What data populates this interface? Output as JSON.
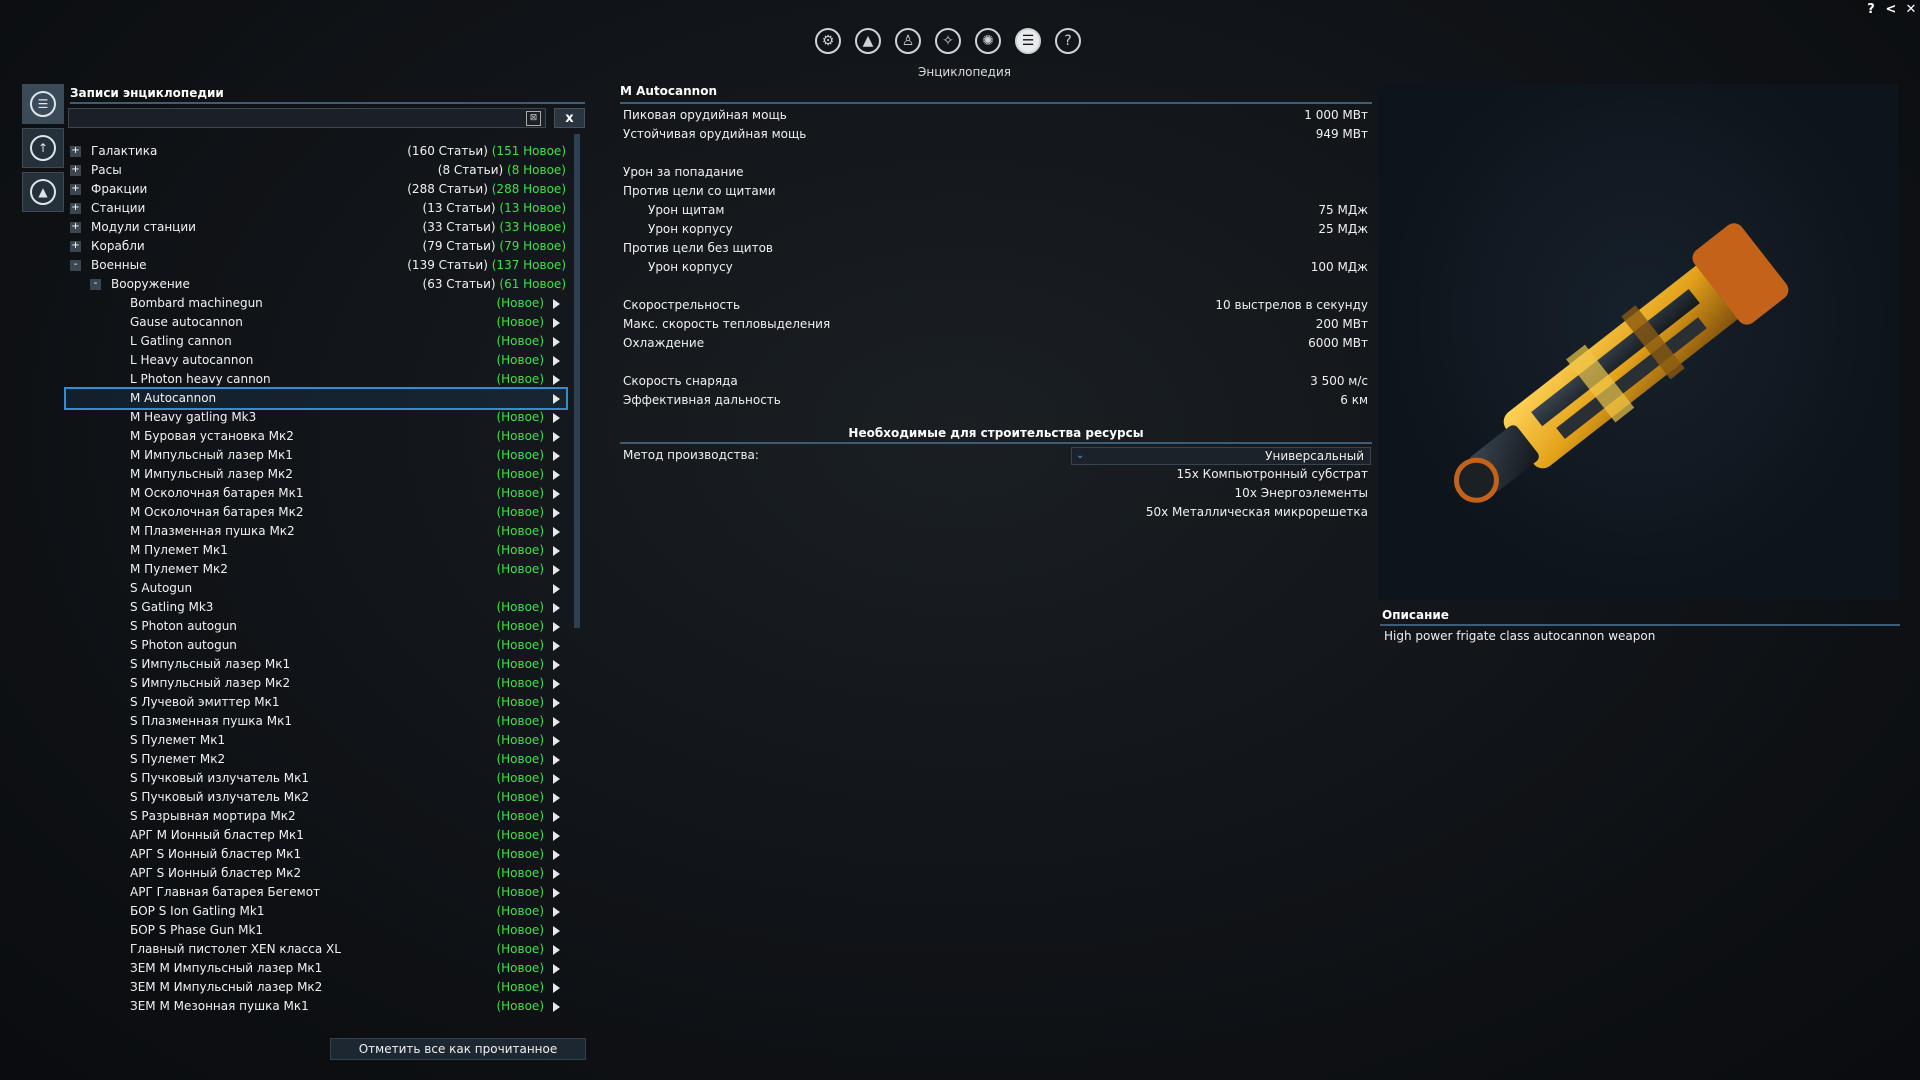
{
  "window_buttons": [
    "?",
    "<",
    "✕"
  ],
  "top_tabs": {
    "icons": [
      "settings-icon",
      "ship-icon",
      "person-icon",
      "rank-icon",
      "network-icon",
      "encyclopedia-icon",
      "help-icon"
    ],
    "glyphs": [
      "⚙",
      "▲",
      "♙",
      "✧",
      "✺",
      "☰",
      "?"
    ],
    "active_index": 5,
    "caption": "Энциклопедия"
  },
  "side_icons": [
    {
      "name": "encyclopedia-side-icon",
      "glyph": "☰",
      "active": true
    },
    {
      "name": "compass-side-icon",
      "glyph": "↑",
      "active": false
    },
    {
      "name": "ship-side-icon",
      "glyph": "▲",
      "active": false
    }
  ],
  "left_panel": {
    "title": "Записи энциклопедии",
    "search": {
      "value": "",
      "placeholder": ""
    },
    "clear_button": "x",
    "mark_all_read": "Отметить все как прочитанное"
  },
  "tree": [
    {
      "label": "Галактика",
      "level": 0,
      "expander": "+",
      "count": "(160 Статьи)",
      "new": "(151 Новое)"
    },
    {
      "label": "Расы",
      "level": 0,
      "expander": "+",
      "count": "(8 Статьи)",
      "new": "(8 Новое)"
    },
    {
      "label": "Фракции",
      "level": 0,
      "expander": "+",
      "count": "(288 Статьи)",
      "new": "(288 Новое)"
    },
    {
      "label": "Станции",
      "level": 0,
      "expander": "+",
      "count": "(13 Статьи)",
      "new": "(13 Новое)"
    },
    {
      "label": "Модули станции",
      "level": 0,
      "expander": "+",
      "count": "(33 Статьи)",
      "new": "(33 Новое)"
    },
    {
      "label": "Корабли",
      "level": 0,
      "expander": "+",
      "count": "(79 Статьи)",
      "new": "(79 Новое)"
    },
    {
      "label": "Военные",
      "level": 0,
      "expander": "-",
      "count": "(139 Статьи)",
      "new": "(137 Новое)"
    },
    {
      "label": "Вооружение",
      "level": 1,
      "expander": "-",
      "count": "(63 Статьи)",
      "new": "(61 Новое)"
    },
    {
      "label": "Bombard machinegun",
      "level": 2,
      "new": "(Новое)"
    },
    {
      "label": "Gause autocannon",
      "level": 2,
      "new": "(Новое)"
    },
    {
      "label": "L Gatling cannon",
      "level": 2,
      "new": "(Новое)"
    },
    {
      "label": "L Heavy autocannon",
      "level": 2,
      "new": "(Новое)"
    },
    {
      "label": "L Photon heavy cannon",
      "level": 2,
      "new": "(Новое)"
    },
    {
      "label": "M Autocannon",
      "level": 2,
      "new": "",
      "selected": true
    },
    {
      "label": "M Heavy gatling Mk3",
      "level": 2,
      "new": "(Новое)"
    },
    {
      "label": "M Буровая установка Мк2",
      "level": 2,
      "new": "(Новое)"
    },
    {
      "label": "M Импульсный лазер Мк1",
      "level": 2,
      "new": "(Новое)"
    },
    {
      "label": "M Импульсный лазер Мк2",
      "level": 2,
      "new": "(Новое)"
    },
    {
      "label": "M Осколочная батарея Мк1",
      "level": 2,
      "new": "(Новое)"
    },
    {
      "label": "M Осколочная батарея Мк2",
      "level": 2,
      "new": "(Новое)"
    },
    {
      "label": "M Плазменная пушка Мк2",
      "level": 2,
      "new": "(Новое)"
    },
    {
      "label": "M Пулемет Мк1",
      "level": 2,
      "new": "(Новое)"
    },
    {
      "label": "M Пулемет Мк2",
      "level": 2,
      "new": "(Новое)"
    },
    {
      "label": "S Autogun",
      "level": 2,
      "new": ""
    },
    {
      "label": "S Gatling Mk3",
      "level": 2,
      "new": "(Новое)"
    },
    {
      "label": "S Photon autogun",
      "level": 2,
      "new": "(Новое)"
    },
    {
      "label": "S Photon autogun",
      "level": 2,
      "new": "(Новое)"
    },
    {
      "label": "S Импульсный лазер Мк1",
      "level": 2,
      "new": "(Новое)"
    },
    {
      "label": "S Импульсный лазер Мк2",
      "level": 2,
      "new": "(Новое)"
    },
    {
      "label": "S Лучевой эмиттер Мк1",
      "level": 2,
      "new": "(Новое)"
    },
    {
      "label": "S Плазменная пушка Мк1",
      "level": 2,
      "new": "(Новое)"
    },
    {
      "label": "S Пулемет Мк1",
      "level": 2,
      "new": "(Новое)"
    },
    {
      "label": "S Пулемет Мк2",
      "level": 2,
      "new": "(Новое)"
    },
    {
      "label": "S Пучковый излучатель Мк1",
      "level": 2,
      "new": "(Новое)"
    },
    {
      "label": "S Пучковый излучатель Мк2",
      "level": 2,
      "new": "(Новое)"
    },
    {
      "label": "S Разрывная мортира Мк2",
      "level": 2,
      "new": "(Новое)"
    },
    {
      "label": "АРГ M Ионный бластер Мк1",
      "level": 2,
      "new": "(Новое)"
    },
    {
      "label": "АРГ S Ионный бластер Мк1",
      "level": 2,
      "new": "(Новое)"
    },
    {
      "label": "АРГ S Ионный бластер Мк2",
      "level": 2,
      "new": "(Новое)"
    },
    {
      "label": "АРГ Главная батарея Бегемот",
      "level": 2,
      "new": "(Новое)"
    },
    {
      "label": "БОР S Ion Gatling Mk1",
      "level": 2,
      "new": "(Новое)"
    },
    {
      "label": "БОР S Phase Gun Mk1",
      "level": 2,
      "new": "(Новое)"
    },
    {
      "label": "Главный пистолет XEN класса XL",
      "level": 2,
      "new": "(Новое)"
    },
    {
      "label": "ЗЕМ M Импульсный лазер Мк1",
      "level": 2,
      "new": "(Новое)"
    },
    {
      "label": "ЗЕМ M Импульсный лазер Мк2",
      "level": 2,
      "new": "(Новое)"
    },
    {
      "label": "ЗЕМ M Мезонная пушка Мк1",
      "level": 2,
      "new": "(Новое)"
    }
  ],
  "detail": {
    "title": "M Autocannon",
    "stats": [
      {
        "k": "Пиковая орудийная мощь",
        "v": "1 000 МВт",
        "ind": false
      },
      {
        "k": "Устойчивая орудийная мощь",
        "v": "949 МВт",
        "ind": false
      },
      {
        "k": "",
        "v": "",
        "ind": false
      },
      {
        "k": "Урон за попадание",
        "v": "",
        "ind": false
      },
      {
        "k": "Против цели со щитами",
        "v": "",
        "ind": false
      },
      {
        "k": "Урон щитам",
        "v": "75 МДж",
        "ind": true
      },
      {
        "k": "Урон корпусу",
        "v": "25 МДж",
        "ind": true
      },
      {
        "k": "Против цели без щитов",
        "v": "",
        "ind": false
      },
      {
        "k": "Урон корпусу",
        "v": "100 МДж",
        "ind": true
      },
      {
        "k": "",
        "v": "",
        "ind": false
      },
      {
        "k": "Скорострельность",
        "v": "10 выстрелов в секунду",
        "ind": false
      },
      {
        "k": "Макс. скорость тепловыделения",
        "v": "200 МВт",
        "ind": false
      },
      {
        "k": "Охлаждение",
        "v": "6000 МВт",
        "ind": false
      },
      {
        "k": "",
        "v": "",
        "ind": false
      },
      {
        "k": "Скорость снаряда",
        "v": "3 500 м/с",
        "ind": false
      },
      {
        "k": "Эффективная дальность",
        "v": "6 км",
        "ind": false
      }
    ],
    "resources_heading": "Необходимые для строительства ресурсы",
    "method_label": "Метод производства:",
    "method_value": "Универсальный",
    "resources": [
      "15x Компьютронный субстрат",
      "10x Энергоэлементы",
      "50x Металлическая микрорешетка"
    ]
  },
  "description": {
    "title": "Описание",
    "text": "High power frigate class autocannon weapon"
  }
}
